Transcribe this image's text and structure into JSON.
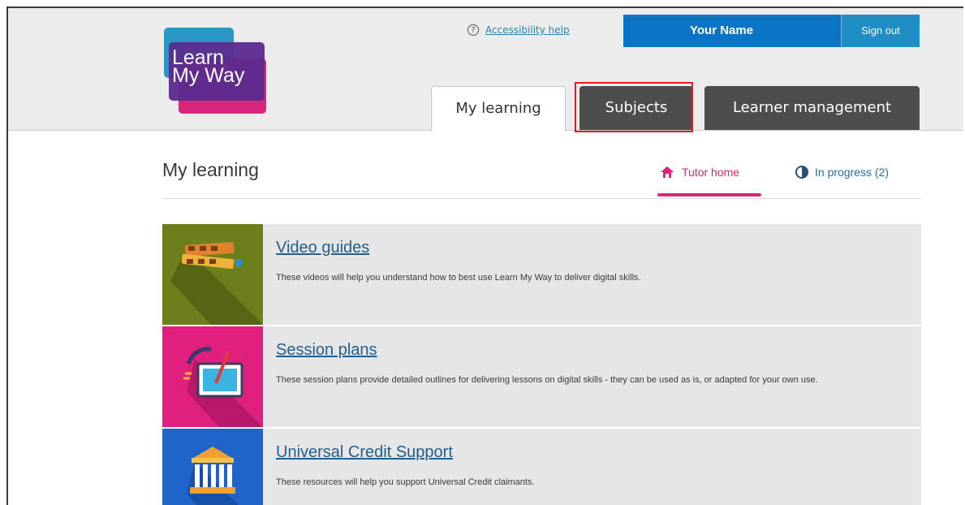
{
  "logo": {
    "text": "Learn\nMy Way"
  },
  "header": {
    "accessibility_help": "Accessibility help",
    "user_name": "Your Name",
    "sign_out": "Sign out"
  },
  "tabs": [
    {
      "label": "My learning",
      "active": true
    },
    {
      "label": "Subjects",
      "active": false,
      "highlighted": true
    },
    {
      "label": "Learner management",
      "active": false
    }
  ],
  "page": {
    "title": "My learning",
    "nav_tutor_home": "Tutor home",
    "nav_in_progress": "In progress (2)"
  },
  "cards": [
    {
      "title": "Video guides",
      "desc": "These videos will help you understand how to best use Learn My Way to deliver digital skills.",
      "thumb_color": "#6b7f1a",
      "icon": "film-strip-icon"
    },
    {
      "title": "Session plans",
      "desc": "These session plans provide detailed outlines for delivering lessons on digital skills - they can be used as is, or adapted for your own use.",
      "thumb_color": "#e0207f",
      "icon": "tablet-icon"
    },
    {
      "title": "Universal Credit Support",
      "desc": "These resources will help you support Universal Credit claimants.",
      "thumb_color": "#1f64c8",
      "icon": "government-building-icon"
    }
  ],
  "colors": {
    "accent_pink": "#d7267b",
    "header_blue": "#0a74c4",
    "tab_dark": "#4d4d4d",
    "highlight_red": "#e02020"
  }
}
